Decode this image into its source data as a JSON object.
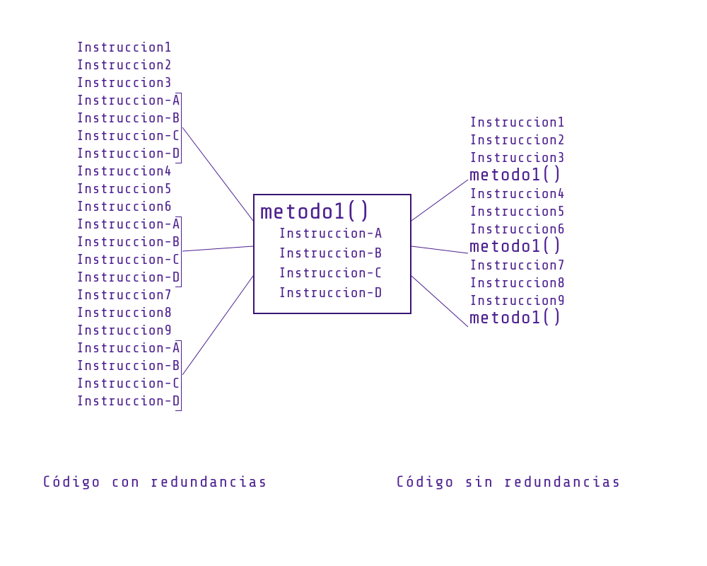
{
  "left_code": {
    "lines": [
      "Instruccion1",
      "Instruccion2",
      "Instruccion3",
      "Instruccion-A",
      "Instruccion-B",
      "Instruccion-C",
      "Instruccion-D",
      "Instruccion4",
      "Instruccion5",
      "Instruccion6",
      "Instruccion-A",
      "Instruccion-B",
      "Instruccion-C",
      "Instruccion-D",
      "Instruccion7",
      "Instruccion8",
      "Instruccion9",
      "Instruccion-A",
      "Instruccion-B",
      "Instruccion-C",
      "Instruccion-D"
    ]
  },
  "right_code": {
    "items": [
      {
        "text": "Instruccion1",
        "call": false
      },
      {
        "text": "Instruccion2",
        "call": false
      },
      {
        "text": "Instruccion3",
        "call": false
      },
      {
        "text": "metodo1()",
        "call": true
      },
      {
        "text": "Instruccion4",
        "call": false
      },
      {
        "text": "Instruccion5",
        "call": false
      },
      {
        "text": "Instruccion6",
        "call": false
      },
      {
        "text": "metodo1()",
        "call": true
      },
      {
        "text": "Instruccion7",
        "call": false
      },
      {
        "text": "Instruccion8",
        "call": false
      },
      {
        "text": "Instruccion9",
        "call": false
      },
      {
        "text": "metodo1()",
        "call": true
      }
    ]
  },
  "method": {
    "title": "metodo1()",
    "body": [
      "Instruccion-A",
      "Instruccion-B",
      "Instruccion-C",
      "Instruccion-D"
    ]
  },
  "captions": {
    "left": "Código con redundancias",
    "right": "Código sin redundancias"
  }
}
